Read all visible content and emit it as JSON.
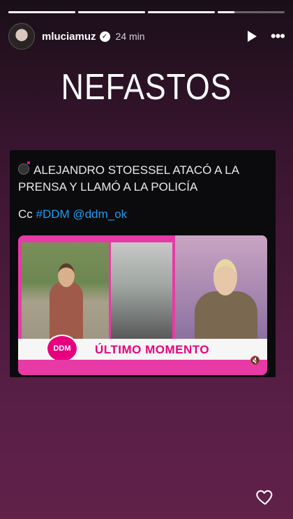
{
  "story": {
    "progress": [
      1,
      1,
      1,
      0.25
    ],
    "username": "mluciamuz",
    "time": "24 min",
    "title": "NEFASTOS"
  },
  "tweet": {
    "text": "ALEJANDRO STOESSEL ATACÓ A LA PRENSA Y LLAMÓ A LA POLICÍA",
    "cc": "Cc",
    "hashtag": "#DDM",
    "mention": "@ddm_ok"
  },
  "video": {
    "lower_third": "ÚLTIMO MOMENTO",
    "logo": "DDM"
  },
  "icons": {
    "verified": "verified-badge-icon",
    "play": "play-icon",
    "more": "more-icon",
    "heart": "heart-icon",
    "mute": "mute-icon"
  }
}
